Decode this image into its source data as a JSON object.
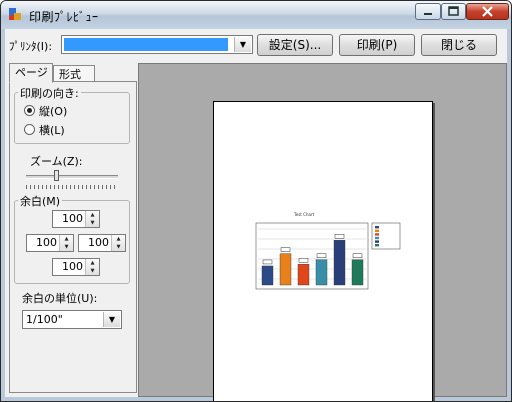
{
  "window": {
    "title": "印刷ﾌﾟﾚﾋﾞｭｰ",
    "buttons": {
      "minimize": "minimize",
      "maximize": "maximize",
      "close": "close"
    }
  },
  "toolbar": {
    "printer_label": "ﾌﾟﾘﾝﾀ(I):",
    "printer_value": "",
    "setup_label": "設定(S)...",
    "print_label": "印刷(P)",
    "close_label": "閉じる"
  },
  "tabs": [
    {
      "label": "ページ",
      "selected": true
    },
    {
      "label": "形式",
      "selected": false
    }
  ],
  "orientation": {
    "title": "印刷の向き:",
    "options": [
      {
        "label": "縦(O)",
        "selected": true
      },
      {
        "label": "横(L)",
        "selected": false
      }
    ]
  },
  "zoom": {
    "label": "ズーム(Z):"
  },
  "margins": {
    "title": "余白(M)",
    "top": "100",
    "left": "100",
    "right": "100",
    "bottom": "100",
    "unit_label": "余白の単位(U):",
    "unit_value": "1/100\""
  },
  "preview": {
    "chart_title": "Test Chart",
    "bar_colors": [
      "#2c4a86",
      "#e8801c",
      "#e0461c",
      "#3a8fa8",
      "#2a3f7a",
      "#1f7a5c"
    ],
    "bar_values": [
      0.34,
      0.56,
      0.37,
      0.45,
      0.8,
      0.45
    ]
  },
  "colors": {
    "accent": "#3399ff",
    "preview_background": "#aaaaaa"
  }
}
